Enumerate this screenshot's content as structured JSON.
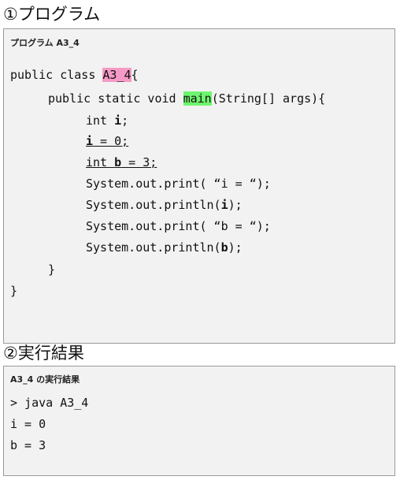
{
  "section1": {
    "heading": "①プログラム",
    "box_title": "プログラム A3_4",
    "code": {
      "l1_pre": "public class ",
      "l1_class": "A3_4",
      "l1_post": "{",
      "l2_pre": "public static void ",
      "l2_main": "main",
      "l2_post": "(String[] args){",
      "l3_pre": "int ",
      "l3_var": "i",
      "l3_post": ";",
      "l4_var": "i",
      "l4_post": " = 0;",
      "l5_pre": "int ",
      "l5_var": "b",
      "l5_post": " = 3;",
      "l6": "System.out.print( “i = “);",
      "l7_pre": "System.out.println(",
      "l7_var": "i",
      "l7_post": ");",
      "l8": "System.out.print( “b = “);",
      "l9_pre": "System.out.println(",
      "l9_var": "b",
      "l9_post": ");",
      "l10": "}",
      "l11": "}"
    }
  },
  "section2": {
    "heading": "②実行結果",
    "box_title": "A3_4 の実行結果",
    "output": [
      "> java A3_4",
      "i = 0",
      "b = 3"
    ]
  },
  "colors": {
    "class_highlight": "#f59ac6",
    "main_highlight": "#6ef56e",
    "box_background": "#f2f2f2"
  }
}
